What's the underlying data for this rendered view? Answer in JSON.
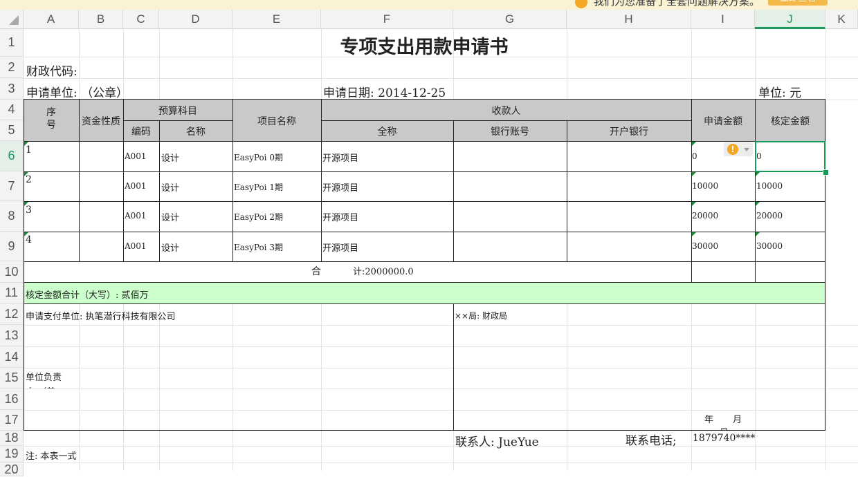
{
  "notice": {
    "text": "我们为您准备了全套问题解决方案。",
    "button": "立即查看"
  },
  "columns": [
    "A",
    "B",
    "C",
    "D",
    "E",
    "F",
    "G",
    "H",
    "I",
    "J",
    "K"
  ],
  "rows": [
    "1",
    "2",
    "3",
    "4",
    "5",
    "6",
    "7",
    "8",
    "9",
    "10",
    "11",
    "12",
    "13",
    "14",
    "15",
    "16",
    "17",
    "18",
    "19",
    "20"
  ],
  "active_cell": {
    "column": "J",
    "row": "6"
  },
  "sheet": {
    "title": "专项支出用款申请书",
    "finance_code": "财政代码:",
    "applicant_unit": "申请单位: （公章）",
    "apply_date": "申请日期: 2014-12-25",
    "unit": "单位: 元",
    "headers": {
      "seq": "序\n号",
      "fund_nature": "资金性质",
      "budget_subject": "预算科目",
      "code": "编码",
      "name": "名称",
      "project_name": "项目名称",
      "payee": "收款人",
      "full_name": "全称",
      "bank_account": "银行账号",
      "bank": "开户银行",
      "apply_amount": "申请金额",
      "approved_amount": "核定金额"
    },
    "items": [
      {
        "seq": "1",
        "code": "A001",
        "name": "设计",
        "project": "EasyPoi 0期",
        "payee": "开源项目",
        "apply": "0",
        "approved": "0"
      },
      {
        "seq": "2",
        "code": "A001",
        "name": "设计",
        "project": "EasyPoi 1期",
        "payee": "开源项目",
        "apply": "10000",
        "approved": "10000"
      },
      {
        "seq": "3",
        "code": "A001",
        "name": "设计",
        "project": "EasyPoi 2期",
        "payee": "开源项目",
        "apply": "20000",
        "approved": "20000"
      },
      {
        "seq": "4",
        "code": "A001",
        "name": "设计",
        "project": "EasyPoi 3期",
        "payee": "开源项目",
        "apply": "30000",
        "approved": "30000"
      }
    ],
    "total_prefix": "合",
    "total_value": "计:2000000.0",
    "approved_total": "核定金额合计（大写）: 贰佰万",
    "payer_unit": "申请支付单位: 执笔潜行科技有限公司",
    "bureau": "××局: 财政局",
    "unit_head": "单位负责",
    "unit_head_cut": "人 （盖",
    "year": "年",
    "month": "月",
    "day": "日",
    "contact": "联系人: JueYue",
    "phone_label": "联系电话;",
    "phone": "1879740****",
    "note": "注: 本表一式"
  },
  "colors": {
    "header_gray": "#c9c9c9",
    "green_row": "#ccffcc",
    "selection": "#1a9a5a",
    "warning": "#f5a623"
  },
  "icons": {
    "warning": "warning-icon",
    "dropdown": "chevron-down-icon",
    "select_all": "select-all-corner"
  }
}
